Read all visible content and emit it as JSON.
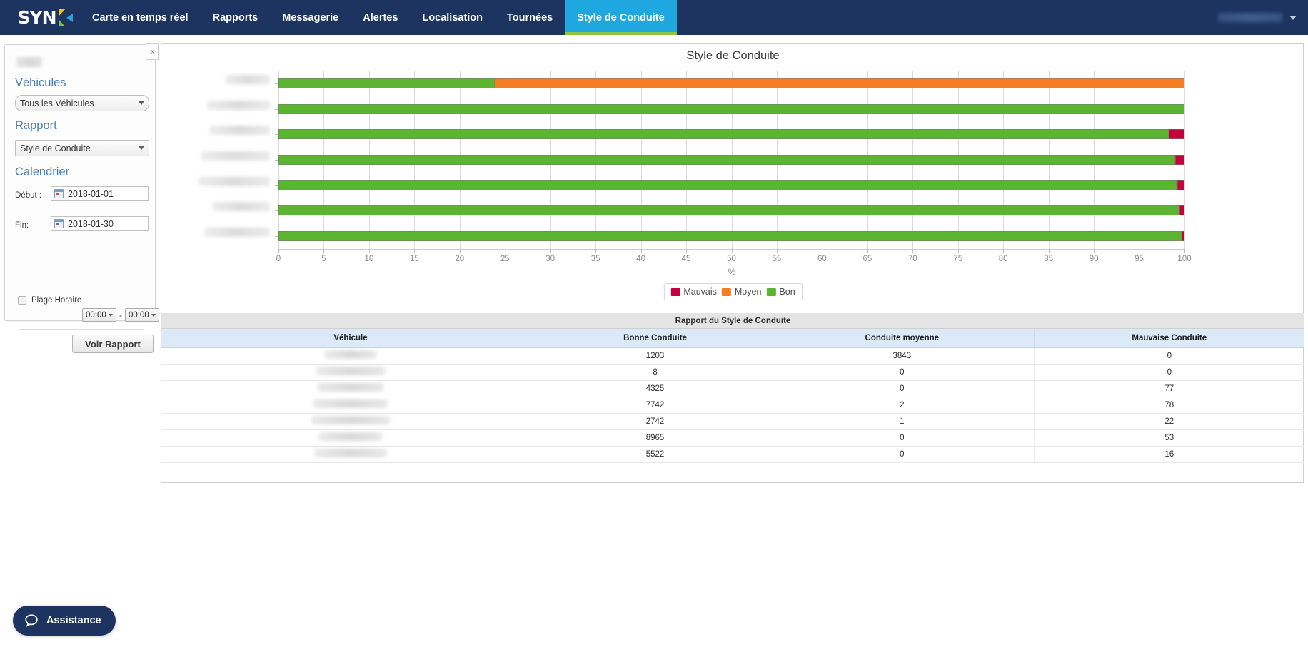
{
  "nav": {
    "logo_text": "SYN",
    "logo_mark": "x-mark-logo",
    "items": [
      {
        "label": "Carte en temps réel",
        "active": false
      },
      {
        "label": "Rapports",
        "active": false
      },
      {
        "label": "Messagerie",
        "active": false
      },
      {
        "label": "Alertes",
        "active": false
      },
      {
        "label": "Localisation",
        "active": false
      },
      {
        "label": "Tournées",
        "active": false
      },
      {
        "label": "Style de Conduite",
        "active": true
      }
    ],
    "user_menu": {
      "label": "",
      "caret": "chevron-down-icon"
    }
  },
  "sidebar": {
    "collapse_label": "«",
    "vehicles_heading": "Véhicules",
    "vehicles_value": "Tous les Véhicules",
    "report_heading": "Rapport",
    "report_value": "Style de Conduite",
    "calendar_heading": "Calendrier",
    "start_label": "Début :",
    "start_value": "2018-01-01",
    "end_label": "Fin:",
    "end_value": "2018-01-30",
    "time_range_label": "Plage Horaire",
    "time_from": "00:00",
    "time_to": "00:00",
    "time_separator": "-",
    "submit_label": "Voir Rapport"
  },
  "chart_data": {
    "type": "bar",
    "orientation": "horizontal",
    "stacked": true,
    "title": "Style de Conduite",
    "xlabel": "%",
    "ylabel": "",
    "xlim": [
      0,
      100
    ],
    "xticks": [
      0,
      5,
      10,
      15,
      20,
      25,
      30,
      35,
      40,
      45,
      50,
      55,
      60,
      65,
      70,
      75,
      80,
      85,
      90,
      95,
      100
    ],
    "grid": true,
    "legend_position": "bottom",
    "legend": [
      {
        "name": "Mauvais",
        "color": "#c4003f"
      },
      {
        "name": "Moyen",
        "color": "#f57c20"
      },
      {
        "name": "Bon",
        "color": "#5cb531"
      }
    ],
    "categories": [
      "",
      "",
      "",
      "",
      "",
      "",
      ""
    ],
    "series": [
      {
        "name": "Bon",
        "color": "#5cb531",
        "values": [
          23.84,
          100.0,
          98.25,
          98.98,
          99.17,
          99.41,
          99.71
        ]
      },
      {
        "name": "Moyen",
        "color": "#f57c20",
        "values": [
          76.16,
          0.0,
          0.0,
          0.03,
          0.04,
          0.0,
          0.0
        ]
      },
      {
        "name": "Mauvais",
        "color": "#c4003f",
        "values": [
          0.0,
          0.0,
          1.75,
          1.0,
          0.8,
          0.59,
          0.29
        ]
      }
    ]
  },
  "table": {
    "caption": "Rapport du Style de Conduite",
    "columns": [
      "Véhicule",
      "Bonne Conduite",
      "Conduite moyenne",
      "Mauvaise Conduite"
    ],
    "rows": [
      {
        "vehicle": "",
        "vehicle_width": 72,
        "bonne": "1203",
        "moyenne": "3843",
        "mauvaise": "0"
      },
      {
        "vehicle": "",
        "vehicle_width": 96,
        "bonne": "8",
        "moyenne": "0",
        "mauvaise": "0"
      },
      {
        "vehicle": "",
        "vehicle_width": 92,
        "bonne": "4325",
        "moyenne": "0",
        "mauvaise": "77"
      },
      {
        "vehicle": "",
        "vehicle_width": 104,
        "bonne": "7742",
        "moyenne": "2",
        "mauvaise": "78"
      },
      {
        "vehicle": "",
        "vehicle_width": 110,
        "bonne": "2742",
        "moyenne": "1",
        "mauvaise": "22"
      },
      {
        "vehicle": "",
        "vehicle_width": 88,
        "bonne": "8965",
        "moyenne": "0",
        "mauvaise": "53"
      },
      {
        "vehicle": "",
        "vehicle_width": 100,
        "bonne": "5522",
        "moyenne": "0",
        "mauvaise": "16"
      }
    ]
  },
  "assistance": {
    "label": "Assistance",
    "icon": "chat-bubble-icon"
  }
}
